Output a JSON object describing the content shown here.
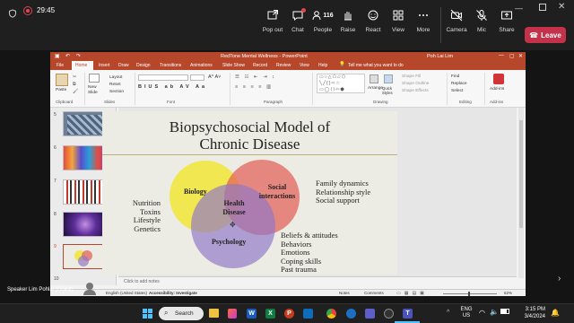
{
  "teams": {
    "timer": "29:45",
    "buttons": [
      {
        "name": "popout",
        "label": "Pop out"
      },
      {
        "name": "chat",
        "label": "Chat"
      },
      {
        "name": "people",
        "label": "People",
        "count": "116"
      },
      {
        "name": "raise",
        "label": "Raise"
      },
      {
        "name": "react",
        "label": "React"
      },
      {
        "name": "view",
        "label": "View"
      },
      {
        "name": "more",
        "label": "More"
      },
      {
        "name": "camera",
        "label": "Camera"
      },
      {
        "name": "mic",
        "label": "Mic"
      },
      {
        "name": "share",
        "label": "Share"
      }
    ],
    "leave_label": "Leave",
    "speaker_label": "Speaker Lim Pohlai (Guest)"
  },
  "ppt": {
    "window_title": "RedTone Mental Wellness - PowerPoint",
    "search_placeholder": "Tell me what you want to do",
    "user_name": "Poh Lai Lim",
    "tabs": [
      "File",
      "Home",
      "Insert",
      "Draw",
      "Design",
      "Transitions",
      "Animations",
      "Slide Show",
      "Record",
      "Review",
      "View",
      "Help"
    ],
    "ribbon_groups": [
      "Clipboard",
      "Slides",
      "Font",
      "Paragraph",
      "Drawing",
      "Editing",
      "Add-ins"
    ],
    "ribbon_items": {
      "paste": "Paste",
      "new_slide": "New Slide",
      "layout": "Layout",
      "reset": "Reset",
      "section": "Section",
      "arrange": "Arrange",
      "quick_styles": "Quick Styles",
      "shape_fill": "Shape Fill",
      "shape_outline": "Shape Outline",
      "shape_effects": "Shape Effects",
      "find": "Find",
      "replace": "Replace",
      "select": "Select",
      "addins": "Add-ins"
    },
    "thumb_numbers": [
      "5",
      "6",
      "7",
      "8",
      "9",
      "10"
    ],
    "notes_placeholder": "Click to add notes",
    "status": {
      "language": "English (United States)",
      "accessibility": "Accessibility: Investigate",
      "notes": "Notes",
      "comments": "Comments",
      "zoom": "62%"
    }
  },
  "slide": {
    "title_line1": "Biopsychosocial Model of",
    "title_line2": "Chronic Disease",
    "circle_bio": "Biology",
    "circle_social_1": "Social",
    "circle_social_2": "interactions",
    "circle_psych": "Psychology",
    "center_1": "Health",
    "center_2": "Disease",
    "left_items": [
      "Nutrition",
      "Toxins",
      "Lifestyle",
      "Genetics"
    ],
    "right_items": [
      "Family dynamics",
      "Relationship style",
      "Social support"
    ],
    "bottom_items": [
      "Beliefs & attitudes",
      "Behaviors",
      "Emotions",
      "Coping skills",
      "Past trauma"
    ],
    "colors": {
      "bio": "#f2e62a",
      "social": "#e25c52",
      "psych": "#9177c9"
    }
  },
  "taskbar": {
    "search_label": "Search",
    "lang_1": "ENG",
    "lang_2": "US",
    "time": "3:15 PM",
    "date": "3/4/2024"
  }
}
